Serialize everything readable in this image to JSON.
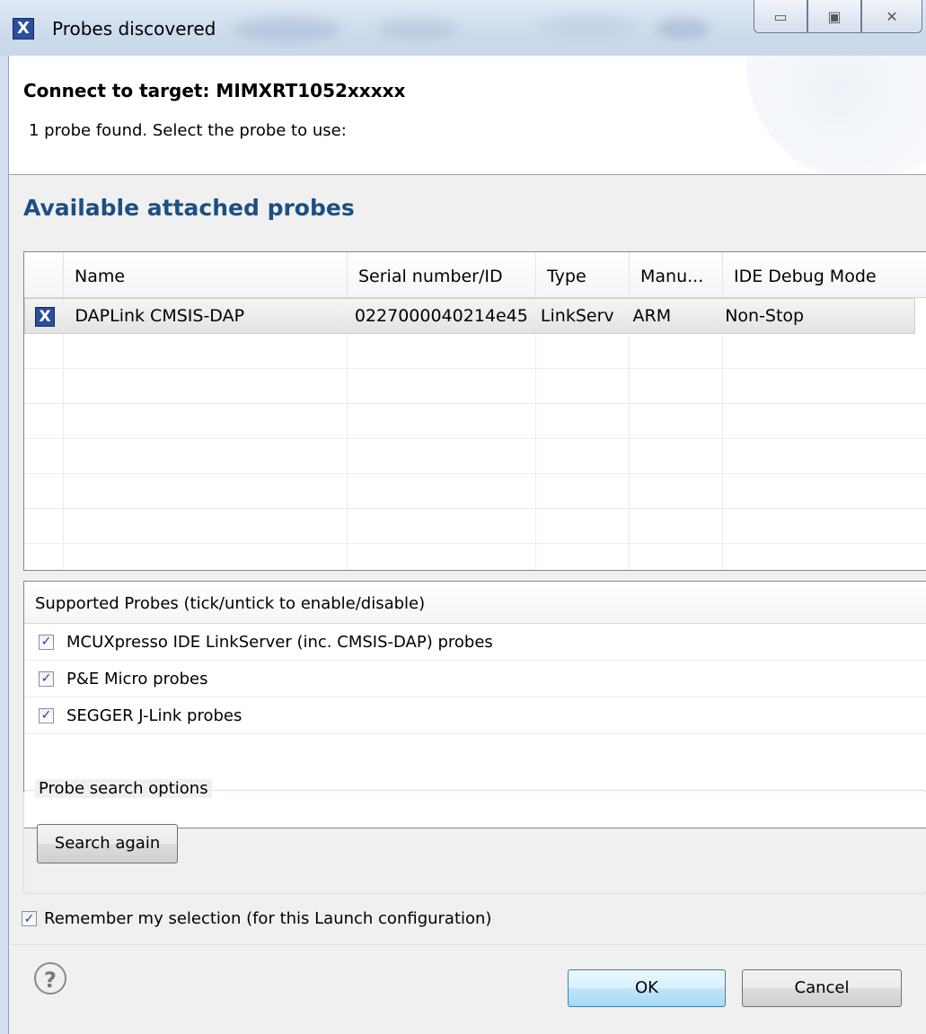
{
  "window": {
    "title": "Probes discovered",
    "icon_glyph": "X",
    "minimize_glyph": "▭",
    "maximize_glyph": "▣",
    "close_glyph": "✕"
  },
  "header": {
    "title": "Connect to target: MIMXRT1052xxxxx",
    "message": "1 probe found. Select the probe to use:"
  },
  "probes": {
    "section_title": "Available attached probes",
    "columns": [
      "Name",
      "Serial number/ID",
      "Type",
      "Manu...",
      "IDE Debug Mode"
    ],
    "rows": [
      {
        "icon": "X",
        "name": "DAPLink CMSIS-DAP",
        "serial": "0227000040214e45",
        "type": "LinkServ",
        "manufacturer": "ARM",
        "mode": "Non-Stop"
      }
    ]
  },
  "supported": {
    "header": "Supported Probes (tick/untick to enable/disable)",
    "check_glyph": "✓",
    "items": [
      {
        "label": "MCUXpresso IDE LinkServer (inc. CMSIS-DAP) probes",
        "checked": true
      },
      {
        "label": "P&E Micro probes",
        "checked": true
      },
      {
        "label": "SEGGER J-Link probes",
        "checked": true
      }
    ]
  },
  "search": {
    "legend": "Probe search options",
    "button_label": "Search again"
  },
  "remember": {
    "label": "Remember my selection (for this Launch configuration)",
    "checked": true
  },
  "footer": {
    "help_glyph": "?",
    "ok_label": "OK",
    "cancel_label": "Cancel"
  },
  "icons": [
    "app-icon",
    "minimize-icon",
    "maximize-icon",
    "close-icon",
    "probe-icon",
    "checkbox-icon",
    "help-icon"
  ]
}
